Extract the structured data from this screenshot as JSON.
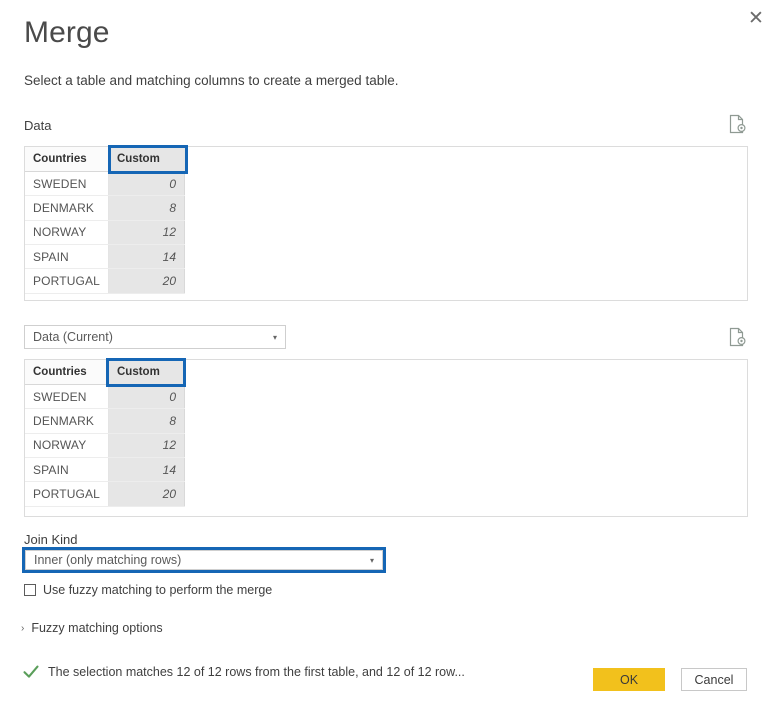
{
  "dialog": {
    "title": "Merge",
    "subtitle": "Select a table and matching columns to create a merged table.",
    "close_label": "✕"
  },
  "sections": {
    "data_label": "Data",
    "join_kind_label": "Join Kind"
  },
  "icons": {
    "settings_top": "table-settings-icon",
    "settings_bottom": "table-settings-icon",
    "dropdown_arrow": "▾",
    "expander_chevron": "›"
  },
  "table_preview": {
    "columns": [
      "Countries",
      "Custom"
    ],
    "selected_column": "Custom",
    "rows": [
      {
        "country": "SWEDEN",
        "custom": "0"
      },
      {
        "country": "DENMARK",
        "custom": "8"
      },
      {
        "country": "NORWAY",
        "custom": "12"
      },
      {
        "country": "SPAIN",
        "custom": "14"
      },
      {
        "country": "PORTUGAL",
        "custom": "20"
      }
    ]
  },
  "table_preview_second": {
    "columns": [
      "Countries",
      "Custom"
    ],
    "selected_column": "Custom",
    "rows": [
      {
        "country": "SWEDEN",
        "custom": "0"
      },
      {
        "country": "DENMARK",
        "custom": "8"
      },
      {
        "country": "NORWAY",
        "custom": "12"
      },
      {
        "country": "SPAIN",
        "custom": "14"
      },
      {
        "country": "PORTUGAL",
        "custom": "20"
      }
    ]
  },
  "table_selector": {
    "value": "Data (Current)"
  },
  "join_kind": {
    "value": "Inner (only matching rows)"
  },
  "fuzzy": {
    "checkbox_label": "Use fuzzy matching to perform the merge",
    "checked": false,
    "options_label": "Fuzzy matching options"
  },
  "status": {
    "message": "The selection matches 12 of 12 rows from the first table, and 12 of 12 row..."
  },
  "footer": {
    "ok_label": "OK",
    "cancel_label": "Cancel"
  },
  "colors": {
    "selection_blue": "#1566b5",
    "ok_yellow": "#f2c11c",
    "status_green": "#5a9e5a"
  }
}
